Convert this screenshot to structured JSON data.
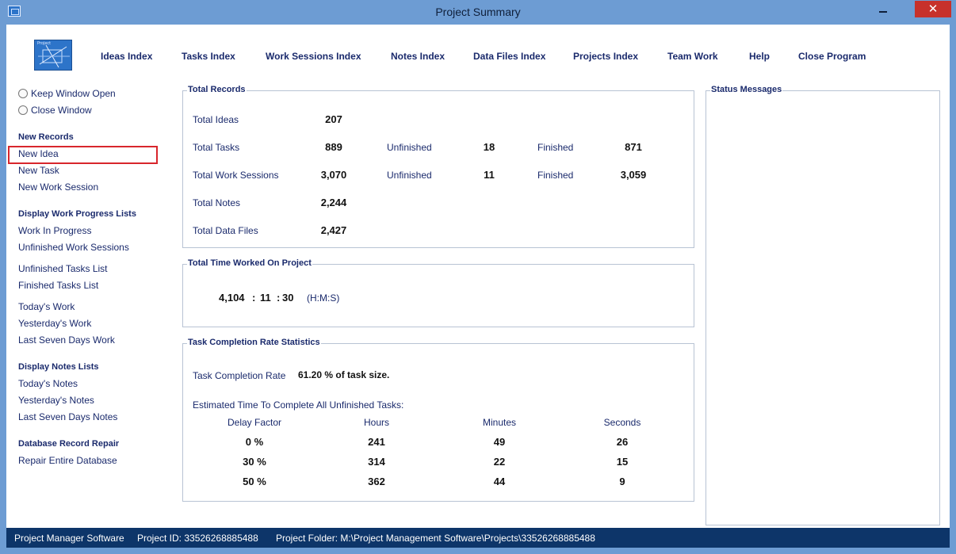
{
  "window": {
    "title": "Project Summary",
    "close_glyph": "✕"
  },
  "logo": {
    "text": "Project",
    "icon": "project-logo-icon"
  },
  "menu": [
    "Ideas Index",
    "Tasks Index",
    "Work Sessions Index",
    "Notes Index",
    "Data Files Index",
    "Projects Index",
    "Team Work",
    "Help",
    "Close Program"
  ],
  "sidebar": {
    "radio_keep": "Keep Window Open",
    "radio_close": "Close Window",
    "new_records": {
      "heading": "New Records",
      "items": [
        "New Idea",
        "New Task",
        "New Work Session"
      ]
    },
    "progress": {
      "heading": "Display Work Progress Lists",
      "items": [
        "Work In Progress",
        "Unfinished Work Sessions",
        "Unfinished Tasks List",
        "Finished Tasks List",
        "Today's Work",
        "Yesterday's Work",
        "Last Seven Days Work"
      ]
    },
    "notes": {
      "heading": "Display Notes Lists",
      "items": [
        "Today's Notes",
        "Yesterday's Notes",
        "Last Seven Days Notes"
      ]
    },
    "repair": {
      "heading": "Database Record Repair",
      "items": [
        "Repair Entire Database"
      ]
    }
  },
  "total_records": {
    "title": "Total Records",
    "ideas": {
      "label": "Total Ideas",
      "value": "207"
    },
    "tasks": {
      "label": "Total Tasks",
      "value": "889",
      "unfinished_label": "Unfinished",
      "unfinished": "18",
      "finished_label": "Finished",
      "finished": "871"
    },
    "sessions": {
      "label": "Total Work Sessions",
      "value": "3,070",
      "unfinished_label": "Unfinished",
      "unfinished": "11",
      "finished_label": "Finished",
      "finished": "3,059"
    },
    "notes": {
      "label": "Total Notes",
      "value": "2,244"
    },
    "files": {
      "label": "Total Data Files",
      "value": "2,427"
    }
  },
  "time_worked": {
    "title": "Total Time Worked On Project",
    "hours": "4,104",
    "sep1": ":",
    "minutes": "11",
    "sep2": ":",
    "seconds": "30",
    "units": "(H:M:S)"
  },
  "completion": {
    "title": "Task Completion Rate Statistics",
    "rate_label": "Task Completion Rate",
    "rate_value": "61.20 % of task size.",
    "estimate_label": "Estimated Time To Complete All Unfinished Tasks:",
    "headers": [
      "Delay Factor",
      "Hours",
      "Minutes",
      "Seconds"
    ],
    "rows": [
      [
        "0 %",
        "241",
        "49",
        "26"
      ],
      [
        "30 %",
        "314",
        "22",
        "15"
      ],
      [
        "50 %",
        "362",
        "44",
        "9"
      ]
    ]
  },
  "status_messages": {
    "title": "Status Messages"
  },
  "statusbar": {
    "software": "Project Manager Software",
    "project_id": "Project ID:  33526268885488",
    "project_folder": "Project Folder: M:\\Project Management Software\\Projects\\33526268885488"
  }
}
